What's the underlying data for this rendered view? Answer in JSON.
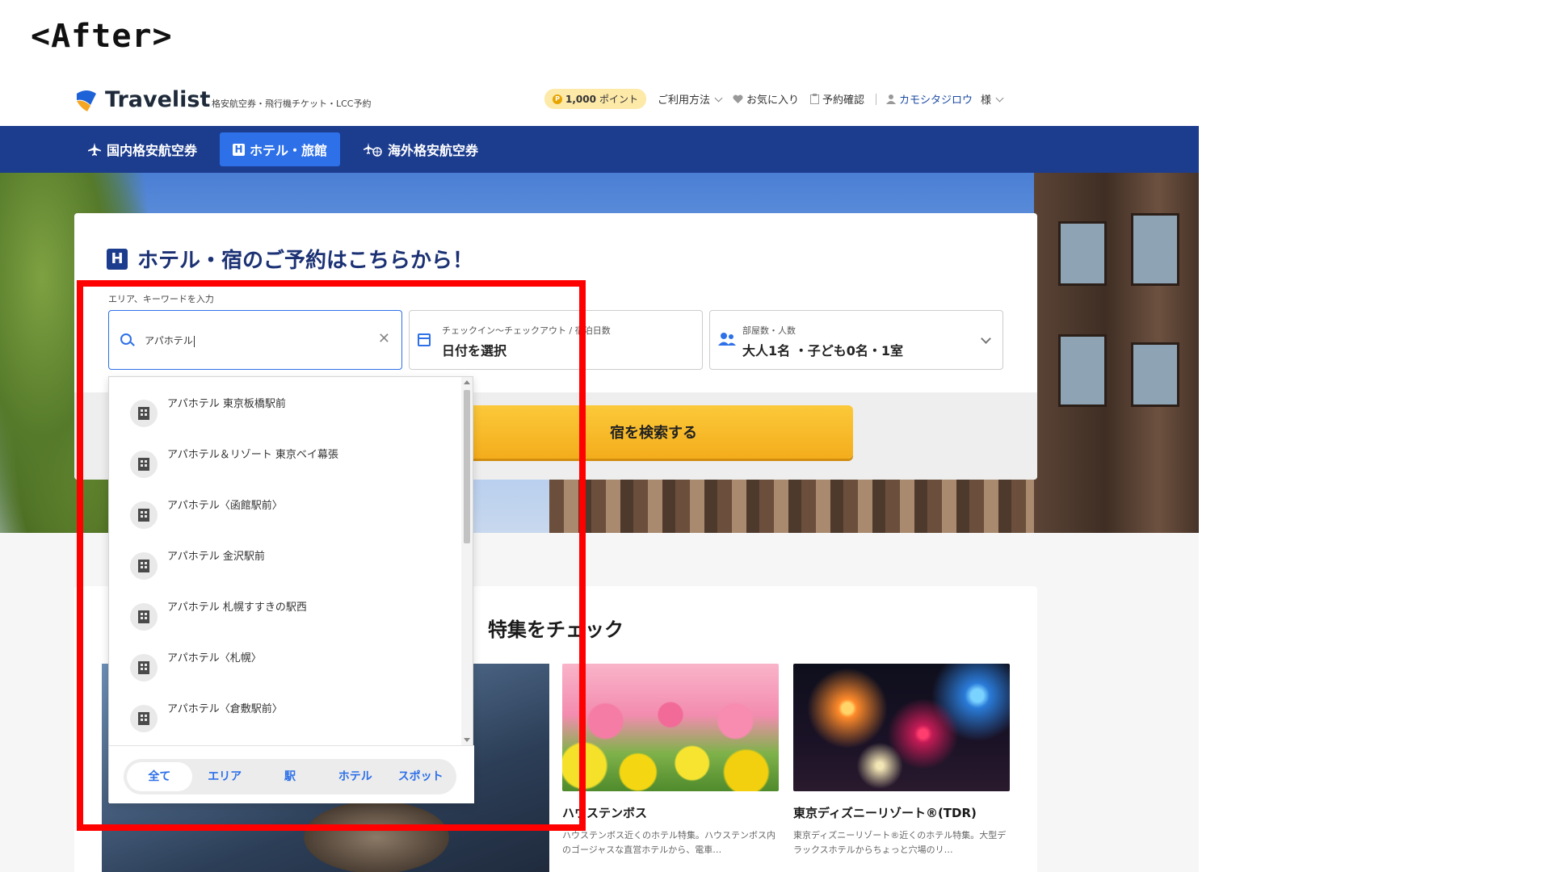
{
  "caption": "<After>",
  "header": {
    "logo_text": "Travelist",
    "tagline": "格安航空券・飛行機チケット・LCC予約",
    "points_value": "1,000",
    "points_unit": "ポイント",
    "links": {
      "how_to_use": "ご利用方法",
      "favorites": "お気に入り",
      "booking_check": "予約確認",
      "user_name": "カモシタジロウ",
      "user_suffix": "様"
    }
  },
  "nav": {
    "items": [
      {
        "label": "国内格安航空券",
        "icon": "plane-icon"
      },
      {
        "label": "ホテル・旅館",
        "icon": "hotel-h-icon",
        "active": true
      },
      {
        "label": "海外格安航空券",
        "icon": "plane-globe-icon"
      }
    ]
  },
  "search": {
    "title": "ホテル・宿のご予約はこちらから！",
    "title_badge": "H",
    "keyword_label": "エリア、キーワードを入力",
    "keyword_value": "アパホテル",
    "date_label": "チェックイン〜チェックアウト / 宿泊日数",
    "date_value": "日付を選択",
    "room_label": "部屋数・人数",
    "room_value": "大人1名 ・子ども0名・1室",
    "search_button": "宿を検索する"
  },
  "dropdown": {
    "suggestions": [
      "アパホテル 東京板橋駅前",
      "アパホテル＆リゾート 東京ベイ幕張",
      "アパホテル〈函館駅前〉",
      "アパホテル 金沢駅前",
      "アパホテル 札幌すすきの駅西",
      "アパホテル〈札幌〉",
      "アパホテル〈倉敷駅前〉"
    ],
    "filters": [
      "全て",
      "エリア",
      "駅",
      "ホテル",
      "スポット"
    ],
    "active_filter": "全て"
  },
  "feature": {
    "title": "特集をチェック",
    "cards": [
      {
        "title": "ハウステンボス",
        "desc": "ハウステンボス近くのホテル特集。ハウステンボス内のゴージャスな直営ホテルから、電車…"
      },
      {
        "title": "東京ディズニーリゾート®(TDR)",
        "desc": "東京ディズニーリゾート®近くのホテル特集。大型デラックスホテルからちょっと穴場のリ…"
      }
    ]
  },
  "colors": {
    "brand_blue": "#1c3c8e",
    "accent_blue": "#2d70e8",
    "highlight_red": "#ff0000",
    "cta_yellow": "#f4ad1c"
  }
}
